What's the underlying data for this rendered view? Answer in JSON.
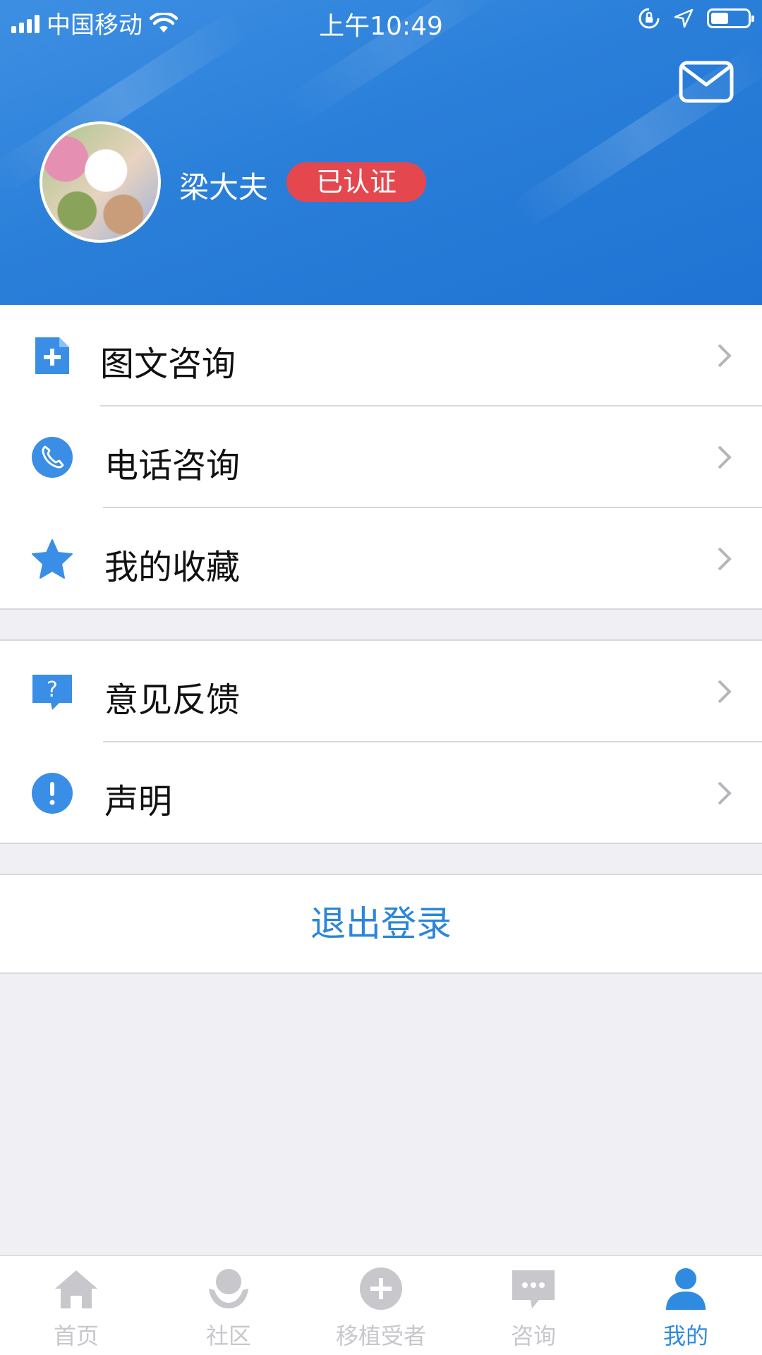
{
  "status_bar": {
    "carrier": "中国移动",
    "time": "上午10:49"
  },
  "profile": {
    "name": "梁大夫",
    "badge": "已认证"
  },
  "menu_group1": [
    {
      "label": "图文咨询",
      "icon": "image-text-doc-icon"
    },
    {
      "label": "电话咨询",
      "icon": "phone-icon"
    },
    {
      "label": "我的收藏",
      "icon": "star-icon"
    }
  ],
  "menu_group2": [
    {
      "label": "意见反馈",
      "icon": "question-bubble-icon"
    },
    {
      "label": "声明",
      "icon": "exclamation-icon"
    }
  ],
  "logout_label": "退出登录",
  "tabs": [
    {
      "label": "首页",
      "icon": "home-icon"
    },
    {
      "label": "社区",
      "icon": "community-icon"
    },
    {
      "label": "移植受者",
      "icon": "plus-circle-icon"
    },
    {
      "label": "咨询",
      "icon": "chat-bubble-icon"
    },
    {
      "label": "我的",
      "icon": "person-icon",
      "active": true
    }
  ],
  "colors": {
    "primary_blue": "#2b86d9",
    "badge_red": "#e5474f",
    "inactive_gray": "#c7c7cc"
  }
}
